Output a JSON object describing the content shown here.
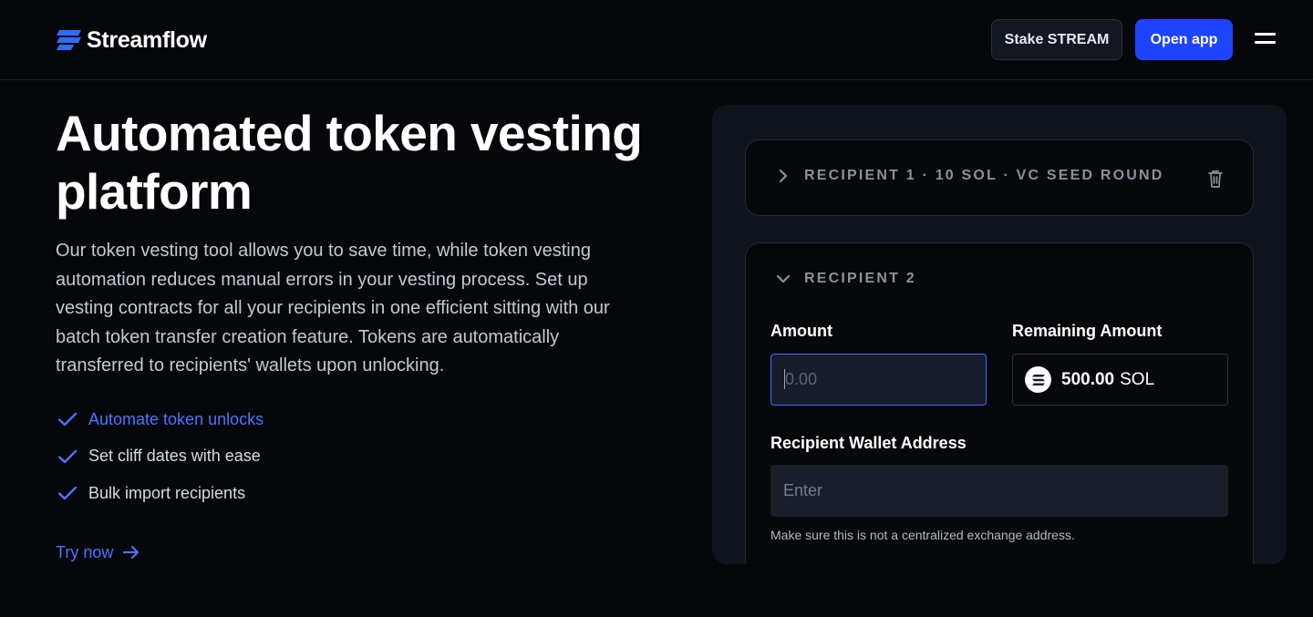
{
  "header": {
    "brand": "Streamflow",
    "stake_label": "Stake STREAM",
    "open_app_label": "Open app",
    "menu_icon": "hamburger-icon"
  },
  "hero": {
    "title": "Automated token vesting platform",
    "description": "Our token vesting tool allows you to save time, while token vesting automation reduces manual errors in your vesting process. Set up vesting contracts for all your recipients in one efficient sitting with our batch token transfer creation feature. Tokens are automatically transferred to recipients' wallets upon unlocking.",
    "features": [
      {
        "label": "Automate token unlocks",
        "active": true
      },
      {
        "label": "Set cliff dates with ease",
        "active": false
      },
      {
        "label": "Bulk import recipients",
        "active": false
      }
    ],
    "cta_label": "Try now"
  },
  "form": {
    "recipient1": {
      "title": "RECIPIENT 1 · 10 SOL · VC SEED ROUND",
      "expanded": false
    },
    "recipient2": {
      "title": "RECIPIENT 2",
      "expanded": true,
      "amount_label": "Amount",
      "amount_placeholder": "0.00",
      "remaining_label": "Remaining Amount",
      "remaining_value": "500.00",
      "remaining_unit": "SOL",
      "wallet_label": "Recipient Wallet Address",
      "wallet_placeholder": "Enter",
      "wallet_hint": "Make sure this is not a centralized exchange address."
    }
  },
  "colors": {
    "background": "#05070b",
    "accent": "#1f44ff",
    "link": "#4d74ff",
    "panel": "#0f131b"
  }
}
